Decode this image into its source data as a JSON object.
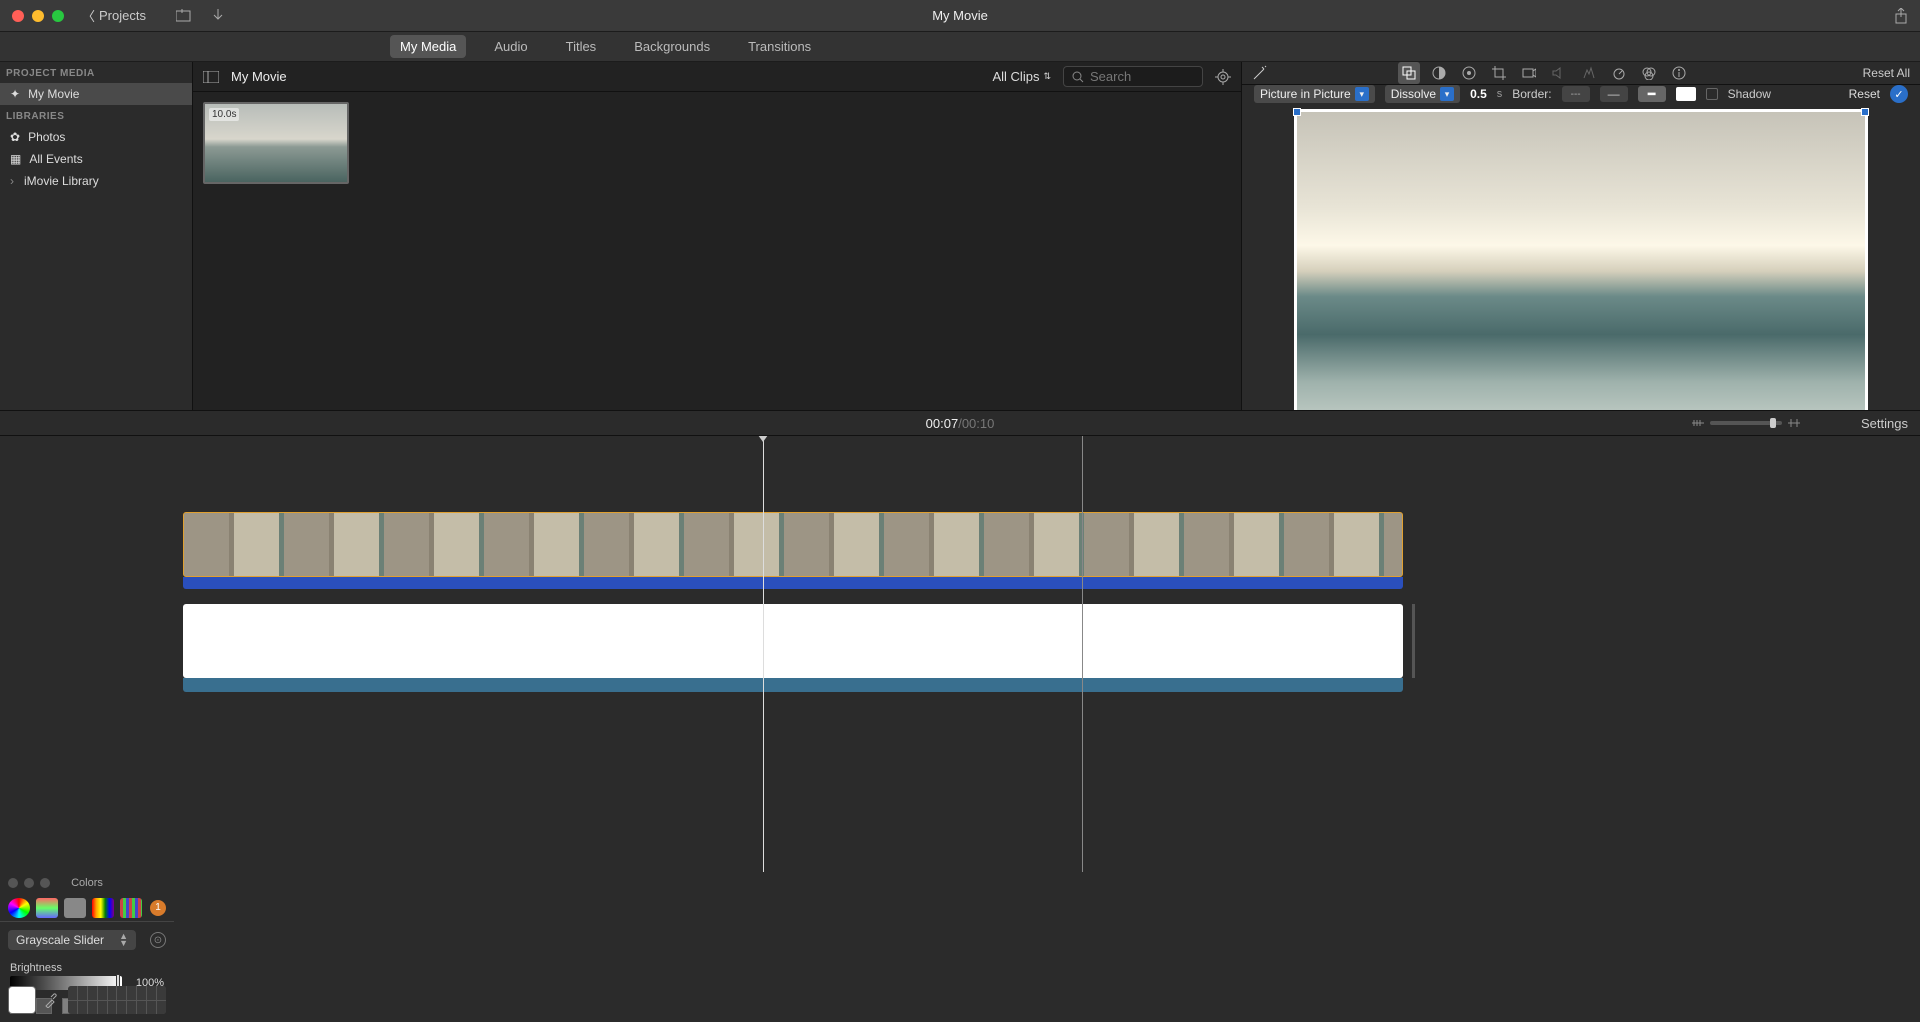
{
  "titlebar": {
    "projects": "Projects",
    "title": "My Movie"
  },
  "tabs": [
    "My Media",
    "Audio",
    "Titles",
    "Backgrounds",
    "Transitions"
  ],
  "active_tab": "My Media",
  "sidebar": {
    "header1": "PROJECT MEDIA",
    "project": "My Movie",
    "header2": "LIBRARIES",
    "items": [
      "Photos",
      "All Events",
      "iMovie Library"
    ]
  },
  "browser": {
    "crumb": "My Movie",
    "filter": "All Clips",
    "search_placeholder": "Search",
    "clip_duration": "10.0s"
  },
  "viewer": {
    "pip": "Picture in Picture",
    "transition": "Dissolve",
    "transition_dur": "0.5",
    "unit": "s",
    "border_label": "Border:",
    "border_styles": [
      "---",
      "—",
      "━"
    ],
    "shadow_label": "Shadow",
    "reset": "Reset",
    "reset_all": "Reset All"
  },
  "timecode": {
    "current": "00:07",
    "sep": " / ",
    "total": "00:10",
    "settings": "Settings"
  },
  "colors_panel": {
    "title": "Colors",
    "mode": "Grayscale Slider",
    "param_label": "Brightness",
    "percent": "100%",
    "badge": "1",
    "swatches": [
      "#000000",
      "#555555",
      "#808080",
      "#bfbfbf",
      "#ffffff"
    ]
  }
}
